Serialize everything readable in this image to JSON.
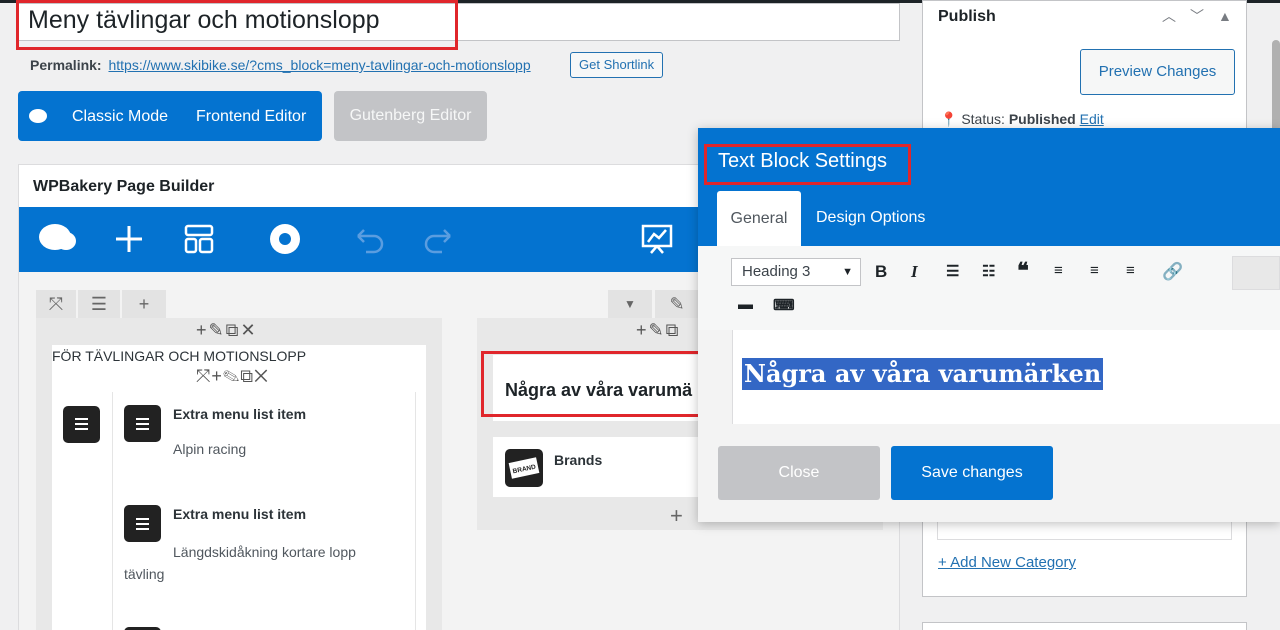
{
  "post": {
    "title": "Meny tävlingar och motionslopp",
    "permalink_label": "Permalink:",
    "permalink_url": "https://www.skibike.se/?cms_block=meny-tavlingar-och-motionslopp",
    "shortlink_button": "Get Shortlink"
  },
  "editor_modes": {
    "classic": "Classic Mode",
    "frontend": "Frontend Editor",
    "gutenberg": "Gutenberg Editor"
  },
  "wpbakery": {
    "title": "WPBakery Page Builder",
    "toolbar_icons": [
      "wpbakery-logo-icon",
      "add-element-icon",
      "templates-icon",
      "settings-icon",
      "undo-icon",
      "redo-icon",
      "preview-icon"
    ]
  },
  "builder": {
    "left_column": {
      "heading": "FÖR TÄVLINGAR OCH MOTIONSLOPP",
      "items": [
        {
          "title": "Extra menu list item",
          "subtitle": "Alpin racing"
        },
        {
          "title": "Extra menu list item",
          "subtitle": "Längdskidåkning kortare lopp tävling"
        }
      ]
    },
    "right_column": {
      "text_block": "Några av våra varumä",
      "brands_label": "Brands",
      "brands_icon_text": "BRAND"
    }
  },
  "publish": {
    "title": "Publish",
    "preview_button": "Preview Changes",
    "status_label": "Status:",
    "status_value": "Published",
    "edit_link": "Edit",
    "add_category": "+ Add New Category"
  },
  "modal": {
    "title": "Text Block Settings",
    "tabs": [
      "General",
      "Design Options"
    ],
    "format_select": "Heading 3",
    "editor_content": "Några av våra varumärken",
    "close_button": "Close",
    "save_button": "Save changes"
  },
  "colors": {
    "accent": "#0473d0",
    "highlight_border": "#e0262b",
    "link": "#2271b1"
  }
}
